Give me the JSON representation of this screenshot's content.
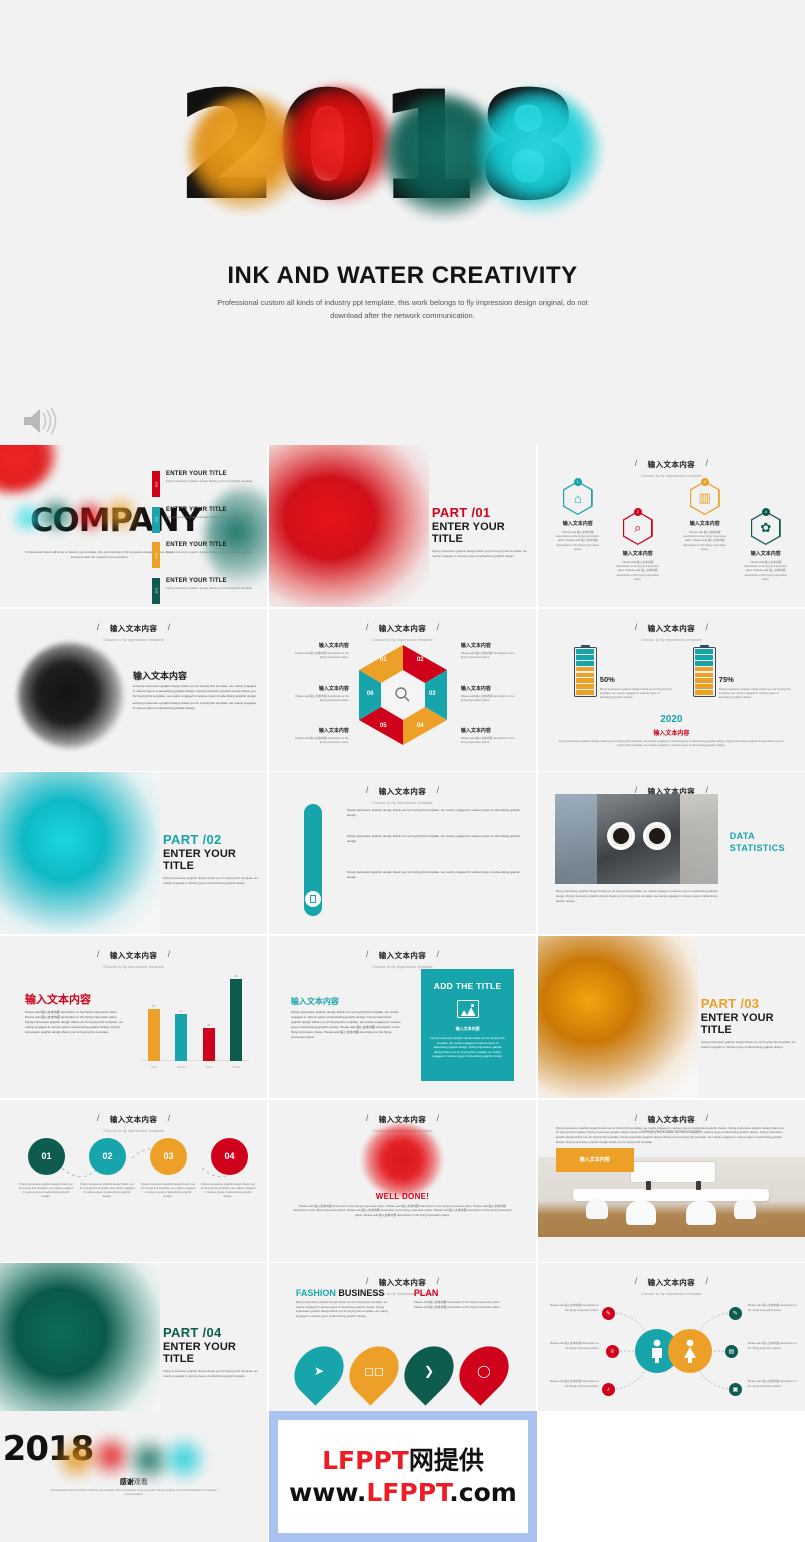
{
  "hero": {
    "year": "2018",
    "title": "INK AND WATER CREATIVITY",
    "subtitle": "Professional custom all kinds of industry ppt template, this work belongs to fly impression design original, do not download after the network communication.",
    "speaker_icon": "speaker-icon"
  },
  "common": {
    "section_title": "输入文本内容",
    "section_sub": "Choose to fly impression template",
    "slash": "/",
    "lorem_short": "Flying impression graphic design thank you for buying this template, we mainly engaged in various types of advertising graphic design.",
    "lorem_cn": "Please add 输入文本内容 description to the flying impression plans."
  },
  "slides": {
    "cover_mini": {
      "brand": "COMPANY",
      "caption": "Professional custom all kinds of industry ppt template, this work belongs to fly impression design original, do not download after the network communication.",
      "items": [
        {
          "tab": "2016",
          "color": "#d0021b",
          "title": "ENTER YOUR TITLE",
          "desc": "Flying impression graphic design thank you for buying this template."
        },
        {
          "tab": "2017",
          "color": "#17a5ab",
          "title": "ENTER YOUR TITLE",
          "desc": "Flying impression graphic design thank you for buying this template."
        },
        {
          "tab": "2018",
          "color": "#eca028",
          "title": "ENTER YOUR TITLE",
          "desc": "Flying impression graphic design thank you for buying this template."
        },
        {
          "tab": "2019",
          "color": "#0d5c4f",
          "title": "ENTER YOUR TITLE",
          "desc": "Flying impression graphic design thank you for buying this template."
        }
      ]
    },
    "part01": {
      "num": "PART /01",
      "color": "#d0021b",
      "title": "ENTER YOUR TITLE",
      "desc": "Flying impression graphic design thank you for buying this template, we mainly engaged in various types of advertising graphic design."
    },
    "part02": {
      "num": "PART /02",
      "color": "#17a5ab",
      "title": "ENTER YOUR TITLE",
      "desc": "Flying impression graphic design thank you for buying this template, we mainly engaged in various types of advertising graphic design."
    },
    "part03": {
      "num": "PART /03",
      "color": "#eca028",
      "title": "ENTER YOUR TITLE",
      "desc": "Flying impression graphic design thank you for buying this template, we mainly engaged in various types of advertising graphic design."
    },
    "part04": {
      "num": "PART /04",
      "color": "#0d5c4f",
      "title": "ENTER YOUR TITLE",
      "desc": "Flying impression graphic design thank you for buying this template, we mainly engaged in various types of advertising graphic design."
    },
    "hex_icons": {
      "items": [
        {
          "badge": "1",
          "color": "#17a5ab",
          "icon": "home-icon",
          "glyph": "⌂",
          "title": "输入文本内容",
          "desc": "Please add 输入文本内容 description to the flying impression plans. Please add 输入文本内容 description to the flying impression plans."
        },
        {
          "badge": "2",
          "color": "#d0021b",
          "icon": "search-icon",
          "glyph": "⌕",
          "title": "输入文本内容",
          "desc": "Please add 输入文本内容 description to the flying impression plans. Please add 输入文本内容 description to the flying impression plans."
        },
        {
          "badge": "3",
          "color": "#eca028",
          "icon": "bar-chart-icon",
          "glyph": "▥",
          "title": "输入文本内容",
          "desc": "Please add 输入文本内容 description to the flying impression plans. Please add 输入文本内容 description to the flying impression plans."
        },
        {
          "badge": "4",
          "color": "#0d5c4f",
          "icon": "gear-icon",
          "glyph": "✿",
          "title": "输入文本内容",
          "desc": "Please add 输入文本内容 description to the flying impression plans. Please add 输入文本内容 description to the flying impression plans."
        }
      ]
    },
    "black_ink": {
      "title": "输入文本内容",
      "bullets": [
        "Flying impression graphic design thank you for buying this template, we mainly engaged in various types of advertising graphic design. Flying impression graphic design thank you for buying this template, we mainly engaged in various types of advertising graphic design.",
        "Flying impression graphic design thank you for buying this template, we mainly engaged in various types of advertising graphic design."
      ]
    },
    "hex_cycle": {
      "segments": [
        {
          "num": "01",
          "color": "#eca028"
        },
        {
          "num": "02",
          "color": "#d0021b"
        },
        {
          "num": "03",
          "color": "#17a5ab"
        },
        {
          "num": "04",
          "color": "#eca028"
        },
        {
          "num": "05",
          "color": "#d0021b"
        },
        {
          "num": "06",
          "color": "#17a5ab"
        }
      ],
      "labels": [
        {
          "title": "输入文本内容",
          "desc": "Please add 输入文本内容 description to the flying impression plans."
        },
        {
          "title": "输入文本内容",
          "desc": "Please add 输入文本内容 description to the flying impression plans."
        },
        {
          "title": "输入文本内容",
          "desc": "Please add 输入文本内容 description to the flying impression plans."
        },
        {
          "title": "输入文本内容",
          "desc": "Please add 输入文本内容 description to the flying impression plans."
        },
        {
          "title": "输入文本内容",
          "desc": "Please add 输入文本内容 description to the flying impression plans."
        },
        {
          "title": "输入文本内容",
          "desc": "Please add 输入文本内容 description to the flying impression plans."
        }
      ]
    },
    "battery": {
      "left": {
        "pct": "50%",
        "fill_teal": 3,
        "fill_orange": 5,
        "desc": "Flying impression graphic design thank you for buying this template, we mainly engaged in various types of advertising graphic design."
      },
      "right": {
        "pct": "75%",
        "fill_teal": 5,
        "fill_orange": 3,
        "desc": "Flying impression graphic design thank you for buying this template, we mainly engaged in various types of advertising graphic design."
      },
      "year": "2020",
      "year_sub": "输入文本内容",
      "year_desc": "Flying impression graphic design thank you for buying this template, we mainly engaged in various types of advertising graphic design. Flying impression graphic design thank you for buying this template, we mainly engaged in various types of advertising graphic design."
    },
    "data_stats": {
      "title_line1": "DATA",
      "title_line2": "STATISTICS",
      "color": "#17a5ab",
      "caption": "Flying impression graphic design thank you for buying this template, we mainly engaged in various types of advertising graphic design. Flying impression graphic design thank you for buying this template, we mainly engaged in various types of advertising graphic design."
    },
    "bar_chart_slide": {
      "title": "输入文本内容",
      "title_color": "#d0021b",
      "body": "Please add 输入文本内容 description to the flying impression plans. Please add 输入文本内容 description to the flying impression plans. Flying impression graphic design thank you for buying this template, we mainly engaged in various types of advertising graphic design. Flying impression graphic design thank you for buying this template."
    },
    "add_title": {
      "left_title": "输入文本内容",
      "left_color": "#17a5ab",
      "left_body": "Flying impression graphic design thank you for buying this template, we mainly engaged in various types of advertising graphic design. Flying impression graphic design thank you for buying this template, we mainly engaged in various types of advertising graphic design. Please add 输入文本内容 description to the flying impression plans. Please add 输入文本内容 description to the flying impression plans.",
      "card_title": "ADD THE TITLE",
      "card_icon": "image-icon",
      "card_sub": "输入文本内容",
      "card_body": "Flying impression graphic design thank you for buying this template, we mainly engaged in various types of advertising graphic design. Flying impression graphic design thank you for buying this template, we mainly engaged in various types of advertising graphic design."
    },
    "timeline": {
      "steps": [
        {
          "num": "01",
          "color": "#0d5c4f",
          "desc": "Flying impression graphic design thank you for buying this template, we mainly engaged in various types of advertising graphic design."
        },
        {
          "num": "02",
          "color": "#17a5ab",
          "desc": "Flying impression graphic design thank you for buying this template, we mainly engaged in various types of advertising graphic design."
        },
        {
          "num": "03",
          "color": "#eca028",
          "desc": "Flying impression graphic design thank you for buying this template, we mainly engaged in various types of advertising graphic design."
        },
        {
          "num": "04",
          "color": "#d0021b",
          "desc": "Flying impression graphic design thank you for buying this template, we mainly engaged in various types of advertising graphic design."
        }
      ]
    },
    "well_done": {
      "title": "WELL DONE!",
      "color": "#d0021b",
      "body": "Please add 输入文本内容 description to the flying impression plans. Please add 输入文本内容 description to the flying impression plans. Please add 输入文本内容 description to the flying impression plans. Please add 输入文本内容 description to the flying impression plans. Please add 输入文本内容 description to the flying impression plans. Please add 输入文本内容 description to the flying impression plans."
    },
    "meeting_room": {
      "body": "Flying impression graphic design thank you for buying this template, we mainly engaged in various types of advertising graphic design. Flying impression graphic design thank you for buying this template. Flying impression graphic design thank you for buying this template, we mainly engaged in various types of advertising graphic design. Flying impression graphic design thank you for buying this template. Flying impression graphic design thank you for buying this template, we mainly engaged in various types of advertising graphic design. Flying impression graphic design thank you for buying this template.",
      "tag": "输入文本内容",
      "tag_color": "#eca028"
    },
    "fashion": {
      "heading_a1": "FASHION",
      "heading_a2": " BUSINESS",
      "heading_a1_color": "#17a5ab",
      "heading_b": "PLAN",
      "heading_b_color": "#d0021b",
      "body_a": "Flying impression graphic design thank you for buying this template, we mainly engaged in various types of advertising graphic design. Flying impression graphic design thank you for buying this template, we mainly engaged in various types of advertising graphic design.",
      "body_b": "Please add 输入文本内容 description to the flying impression plans. Please add 输入文本内容 description to the flying impression plans.",
      "leaves": [
        {
          "color": "#17a5ab",
          "icon": "cursor-icon",
          "glyph": "➤"
        },
        {
          "color": "#eca028",
          "icon": "glasses-icon",
          "glyph": "◻◻"
        },
        {
          "color": "#0d5c4f",
          "icon": "chat-icon",
          "glyph": "❯"
        },
        {
          "color": "#d0021b",
          "icon": "lightbulb-icon",
          "glyph": "◯"
        }
      ]
    },
    "gender_map": {
      "male_color": "#17a5ab",
      "female_color": "#eca028",
      "male_icon": "male-icon",
      "female_icon": "female-icon",
      "left_items": [
        {
          "color": "#d0021b",
          "icon": "pin-icon",
          "glyph": "✎",
          "text": "Please add 输入文本内容 description to the flying impression plans."
        },
        {
          "color": "#d0021b",
          "icon": "shirt-icon",
          "glyph": "♕",
          "text": "Please add 输入文本内容 description to the flying impression plans."
        },
        {
          "color": "#d0021b",
          "icon": "sound-icon",
          "glyph": "♪",
          "text": "Please add 输入文本内容 description to the flying impression plans."
        }
      ],
      "right_items": [
        {
          "color": "#0d5c4f",
          "icon": "pen-icon",
          "glyph": "✎",
          "text": "Please add 输入文本内容 description to the flying impression plans."
        },
        {
          "color": "#0d5c4f",
          "icon": "note-icon",
          "glyph": "▤",
          "text": "Please add 输入文本内容 description to the flying impression plans."
        },
        {
          "color": "#0d5c4f",
          "icon": "bag-icon",
          "glyph": "▣",
          "text": "Please add 输入文本内容 description to the flying impression plans."
        }
      ]
    },
    "thank_you": {
      "year": "2018",
      "thanks_bold": "感谢",
      "thanks_rest": "观看",
      "desc": "Professional custom all kinds of industry ppt template, this work belongs to fly impression design original, do not download after the network communication."
    }
  },
  "watermark": {
    "line1_red": "LFPPT",
    "line1_black": "网提供",
    "line2_a": "www.",
    "line2_red": "LFPPT",
    "line2_b": ".com"
  },
  "chart_data": {
    "type": "bar",
    "categories": [
      "First",
      "Second",
      "Third",
      "Fourth"
    ],
    "values": [
      52,
      47,
      33,
      82
    ],
    "value_labels": [
      "52",
      "47",
      "33",
      "82"
    ],
    "colors": [
      "#eca028",
      "#17a5ab",
      "#d0021b",
      "#0d5c4f"
    ],
    "title": "输入文本内容",
    "xlabel": "",
    "ylabel": "",
    "ylim": [
      0,
      100
    ],
    "grid": false,
    "legend": "none"
  }
}
